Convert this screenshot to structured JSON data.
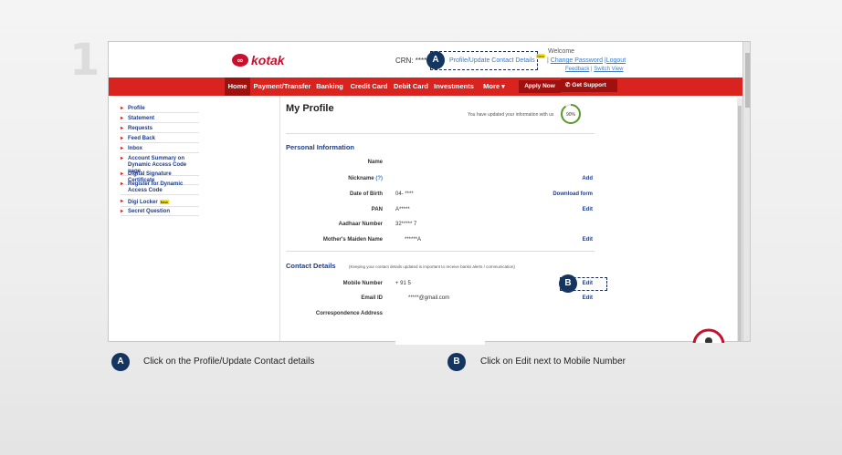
{
  "step_number": "1",
  "header": {
    "logo_text": "kotak",
    "crn_label": "CRN: *****",
    "profile_link": "Profile/Update Contact Details",
    "new_badge": "New",
    "welcome": "Welcome",
    "change_password": "Change Password",
    "logout": "Logout",
    "feedback": "Feedback",
    "switch_view": "Switch View"
  },
  "nav": {
    "items": [
      "Home",
      "Payment/Transfer",
      "Banking",
      "Credit Card",
      "Debit Card",
      "Investments",
      "More ▾"
    ],
    "apply_now": "Apply Now",
    "get_support": "Get Support"
  },
  "sidebar": {
    "items": [
      "Profile",
      "Statement",
      "Requests",
      "Feed Back",
      "Inbox",
      "Account Summary on Dynamic Access Code page.",
      "Digital Signature Certificate",
      "Register for Dynamic Access Code",
      "Digi Locker",
      "Secret Question"
    ],
    "digi_new": "New"
  },
  "main": {
    "title": "My Profile",
    "updated_text": "You have updated your information with us",
    "progress_text": "90%",
    "progress_value": 0.9,
    "personal_section": "Personal Information",
    "contact_section": "Contact Details",
    "contact_note": "(Keeping your contact details updated is important to receive banks alerts / communication)",
    "fields": {
      "name_label": "Name",
      "nickname_label": "Nickname",
      "nickname_help": "(?)",
      "nickname_action": "Add",
      "dob_label": "Date of Birth",
      "dob_value": "04-      ****",
      "dob_action": "Download form",
      "pan_label": "PAN",
      "pan_value": "A*****",
      "pan_action": "Edit",
      "aadhaar_label": "Aadhaar Number",
      "aadhaar_value": "32*****      7",
      "mmn_label": "Mother's Maiden Name",
      "mmn_value": "******A",
      "mmn_action": "Edit",
      "mobile_label": "Mobile Number",
      "mobile_value": "+ 91 5",
      "mobile_action": "Edit",
      "email_label": "Email ID",
      "email_value": "*****@gmail.com",
      "email_action": "Edit",
      "corr_label": "Correspondence Address"
    }
  },
  "callouts": {
    "a": "A",
    "b": "B",
    "a_text": "Click on the Profile/Update Contact details",
    "b_text": "Click on Edit next to Mobile Number"
  },
  "colors": {
    "brand_red": "#d8231f",
    "link_blue": "#3a7bc8",
    "badge_navy": "#13355f",
    "progress_green": "#5b9a2a"
  }
}
